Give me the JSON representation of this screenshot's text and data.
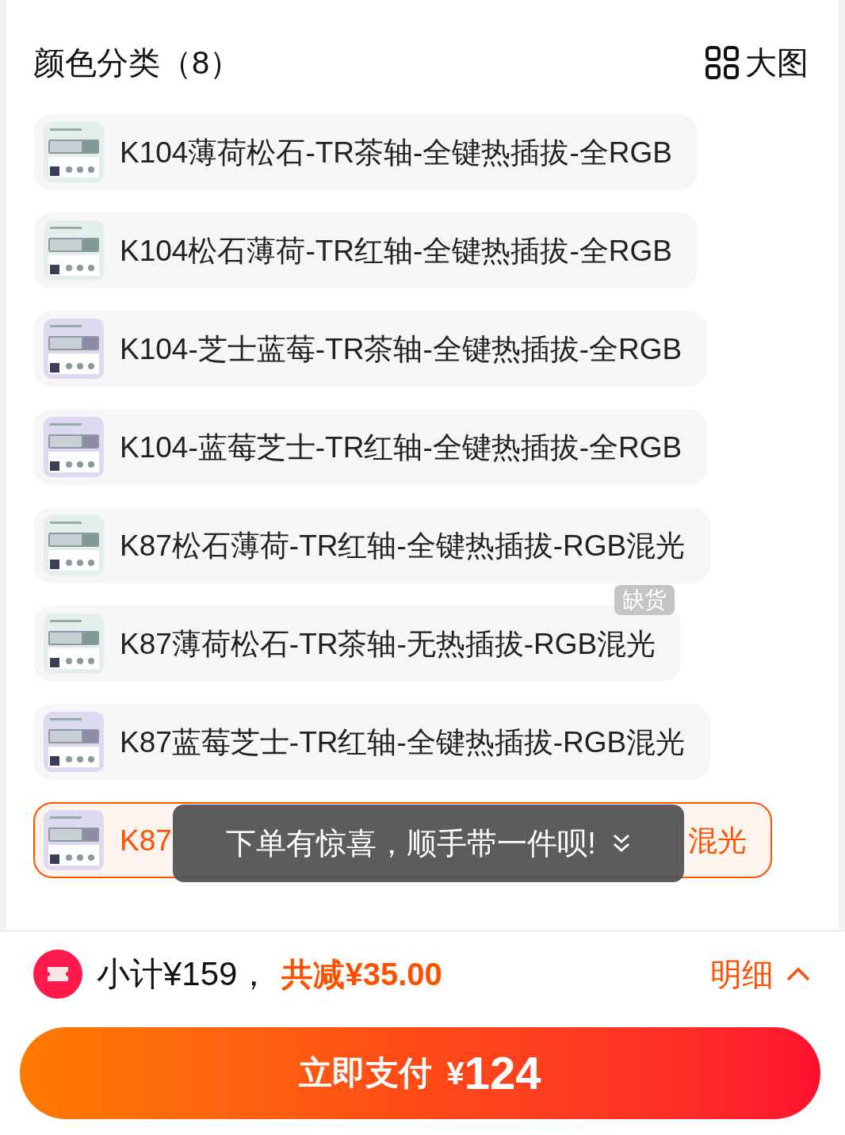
{
  "header": {
    "title": "颜色分类（8）",
    "view_label": "大图"
  },
  "options": [
    {
      "label": "K104薄荷松石-TR茶轴-全键热插拔-全RGB",
      "selected": false
    },
    {
      "label": "K104松石薄荷-TR红轴-全键热插拔-全RGB",
      "selected": false
    },
    {
      "label": "K104-芝士蓝莓-TR茶轴-全键热插拔-全RGB",
      "selected": false
    },
    {
      "label": "K104-蓝莓芝士-TR红轴-全键热插拔-全RGB",
      "selected": false
    },
    {
      "label": "K87松石薄荷-TR红轴-全键热插拔-RGB混光",
      "selected": false
    },
    {
      "label": "K87薄荷松石-TR茶轴-无热插拔-RGB混光",
      "selected": false,
      "badge": "缺货"
    },
    {
      "label": "K87蓝莓芝士-TR红轴-全键热插拔-RGB混光",
      "selected": false
    },
    {
      "label": "K87",
      "label_end": "混光",
      "selected": true
    }
  ],
  "toast": "下单有惊喜，顺手带一件呗!",
  "summary": {
    "subtotal": "小计¥159，",
    "discount": "共减¥35.00",
    "details": "明细"
  },
  "pay_button": {
    "label": "立即支付",
    "currency": "¥",
    "amount": "124"
  }
}
